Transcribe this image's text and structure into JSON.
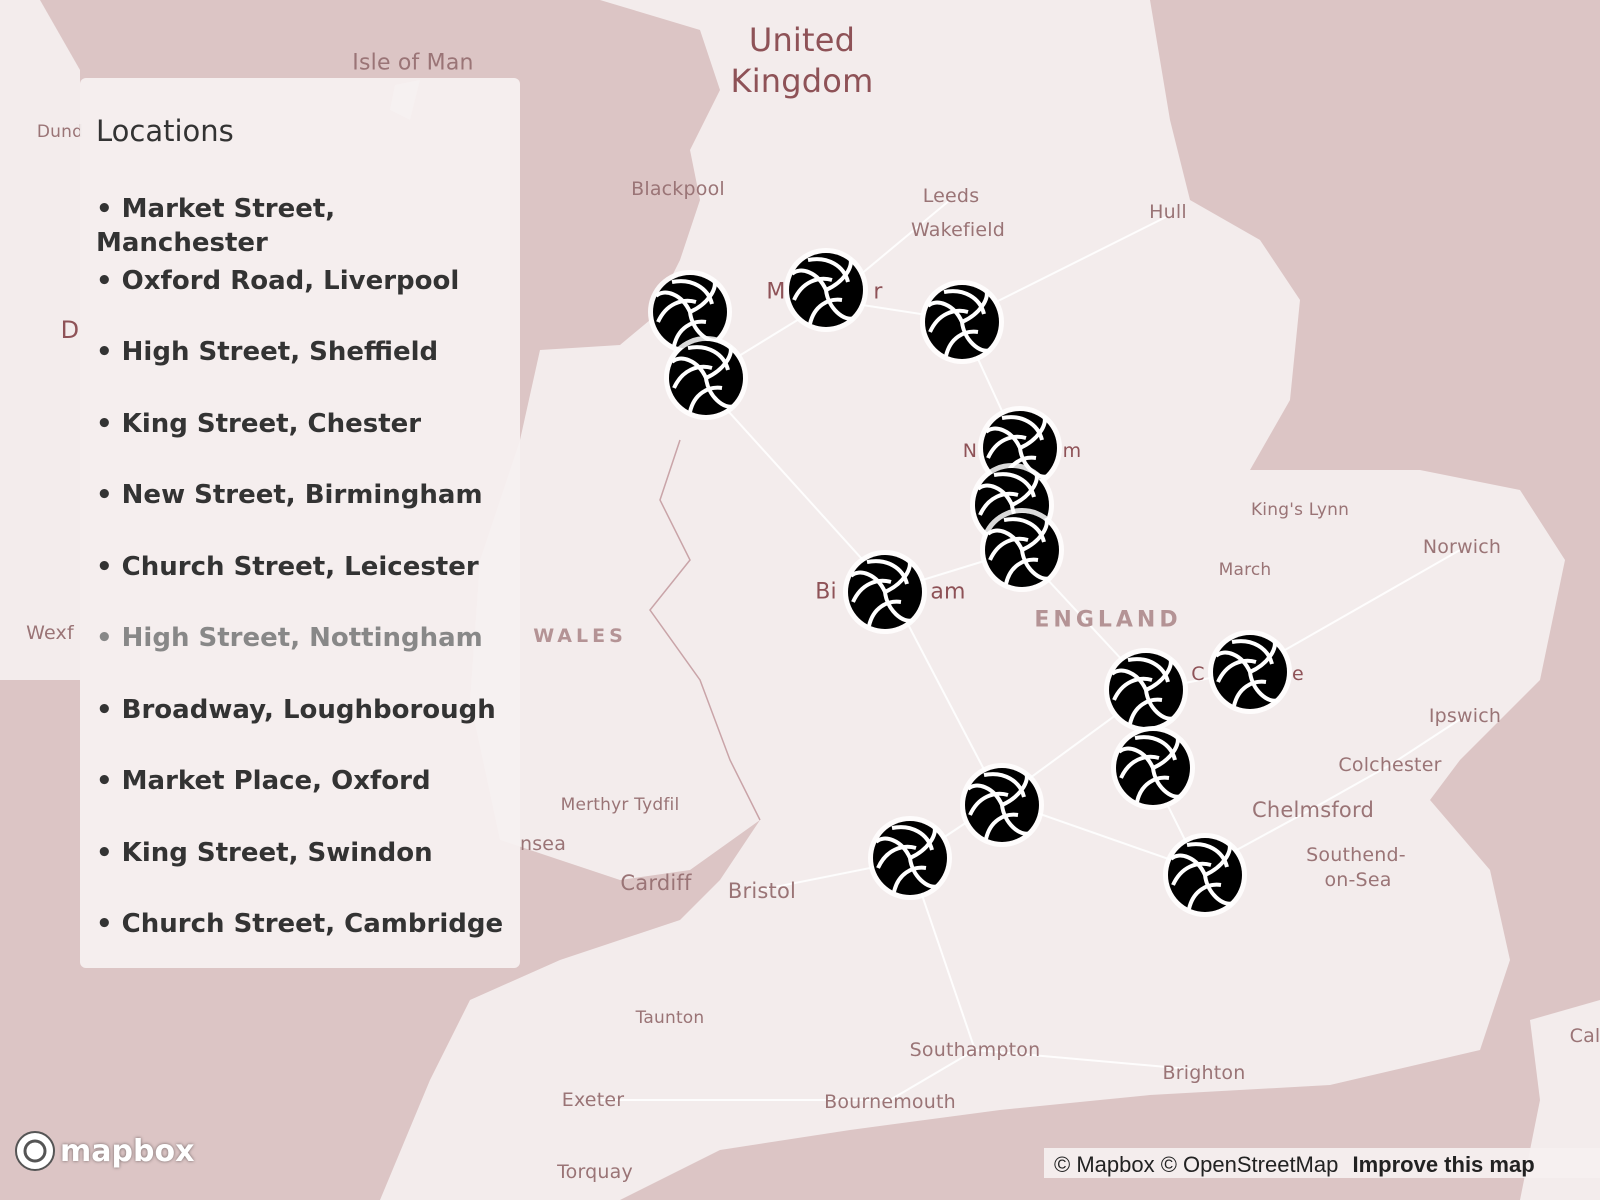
{
  "colors": {
    "sea": "#dcc5c5",
    "land": "#f3ecec",
    "label": "#9a7476",
    "marker_icon": "#000000"
  },
  "map_labels": {
    "uk_1": "United",
    "uk_2": "Kingdom",
    "isle_of_man": "Isle of Man",
    "blackpool": "Blackpool",
    "leeds": "Leeds",
    "wakefield": "Wakefield",
    "hull": "Hull",
    "kings_lynn": "King's Lynn",
    "norwich": "Norwich",
    "march": "March",
    "england": "ENGLAND",
    "wales": "WALES",
    "ipswich": "Ipswich",
    "colchester": "Colchester",
    "chelmsford": "Chelmsford",
    "southend_1": "Southend-",
    "southend_2": "on-Sea",
    "merthyr": "Merthyr Tydfil",
    "cardiff": "Cardiff",
    "bristol": "Bristol",
    "swansea_partial": "nsea",
    "taunton": "Taunton",
    "southampton": "Southampton",
    "brighton": "Brighton",
    "exeter": "Exeter",
    "bournemouth": "Bournemouth",
    "torquay": "Torquay",
    "dundalk_partial": "Dund",
    "dublin_partial": "D",
    "wexford_partial": "Wexf",
    "calais_partial": "Cal",
    "manchester_m": "M",
    "manchester_r": "r",
    "birmingham_bi": "Bi",
    "birmingham_am": "am",
    "nottingham_n": "N",
    "nottingham_m": "m",
    "cambridge_c": "C",
    "cambridge_e": "e"
  },
  "markers_icon": "volleyball-icon",
  "panel": {
    "title": "Locations",
    "items": [
      {
        "label": "• Market Street, Manchester"
      },
      {
        "label": "• Oxford Road, Liverpool"
      },
      {
        "label": "• High Street, Sheffield"
      },
      {
        "label": "• King Street, Chester"
      },
      {
        "label": "• New Street, Birmingham"
      },
      {
        "label": "• Church Street, Leicester"
      },
      {
        "label": "• High Street, Nottingham",
        "dimmed": true
      },
      {
        "label": "• Broadway, Loughborough"
      },
      {
        "label": "• Market Place, Oxford"
      },
      {
        "label": "• King Street, Swindon"
      },
      {
        "label": "• Church Street, Cambridge"
      }
    ]
  },
  "logo": {
    "text": "mapbox"
  },
  "attribution": {
    "mapbox": "© Mapbox",
    "osm": "© OpenStreetMap",
    "improve": "Improve this map"
  }
}
